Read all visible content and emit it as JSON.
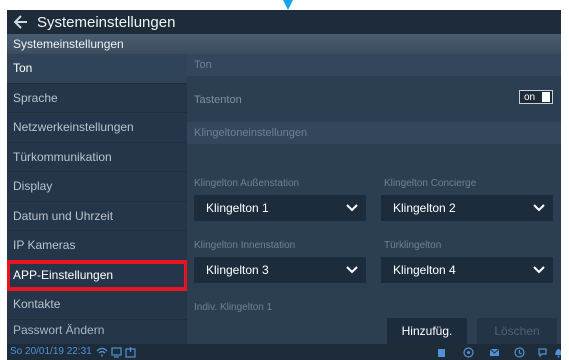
{
  "window": {
    "title": "Systemeinstellungen",
    "subtitle": "Systemeinstellungen"
  },
  "sidebar": {
    "items": [
      {
        "label": "Ton"
      },
      {
        "label": "Sprache"
      },
      {
        "label": "Netzwerkeinstellungen"
      },
      {
        "label": "Türkommunikation"
      },
      {
        "label": "Display"
      },
      {
        "label": "Datum und Uhrzeit"
      },
      {
        "label": "IP Kameras"
      },
      {
        "label": "APP-Einstellungen"
      },
      {
        "label": "Kontakte"
      },
      {
        "label": "Passwort Ändern"
      }
    ]
  },
  "content": {
    "section_ton": "Ton",
    "tastenton_label": "Tastenton",
    "tastenton_toggle": "on",
    "section_klingel": "Klingeltoneinstellungen",
    "fields": [
      {
        "label": "Klingelton Außenstation",
        "value": "Klingelton 1"
      },
      {
        "label": "Klingelton Concierge",
        "value": "Klingelton 2"
      },
      {
        "label": "Klingelton Innenstation",
        "value": "Klingelton 3"
      },
      {
        "label": "Türklingelton",
        "value": "Klingelton 4"
      }
    ],
    "indiv_label": "Indiv. Klingelton 1",
    "add_button": "Hinzufüg.",
    "delete_button": "Löschen"
  },
  "statusbar": {
    "datetime": "So 20/01/19  22:31"
  },
  "colors": {
    "highlight": "#e8141e",
    "accent": "#4f93d6"
  }
}
